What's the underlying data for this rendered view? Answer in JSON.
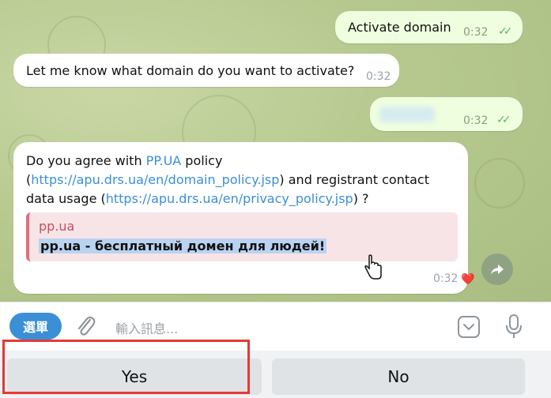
{
  "messages": {
    "activate": {
      "text": "Activate domain",
      "time": "0:32",
      "ticks": "✓✓"
    },
    "ask": {
      "text": "Let me know what domain do you want to activate?",
      "time": "0:32"
    },
    "blurred": {
      "time": "0:32",
      "ticks": "✓✓"
    },
    "policy": {
      "line1_prefix": "Do you agree with ",
      "line1_link": "PP.UA",
      "line1_suffix": " policy",
      "line2_open": "(",
      "line2_link": "https://apu.drs.ua/en/domain_policy.jsp",
      "line2_suffix": ") and registrant contact",
      "line3_prefix": "data usage (",
      "line3_link": "https://apu.drs.ua/en/privacy_policy.jsp",
      "line3_suffix": ") ?",
      "preview_title": "pp.ua",
      "preview_desc": "pp.ua - бесплатный домен для людей!",
      "time": "0:32",
      "reaction": "❤️"
    }
  },
  "input": {
    "menu_label": "選單",
    "placeholder": "輸入訊息..."
  },
  "keyboard": {
    "yes_label": "Yes",
    "no_label": "No"
  },
  "icons": {
    "share": "share-icon",
    "attach": "paperclip-icon",
    "emoji": "sticker-icon",
    "mic": "microphone-icon"
  }
}
